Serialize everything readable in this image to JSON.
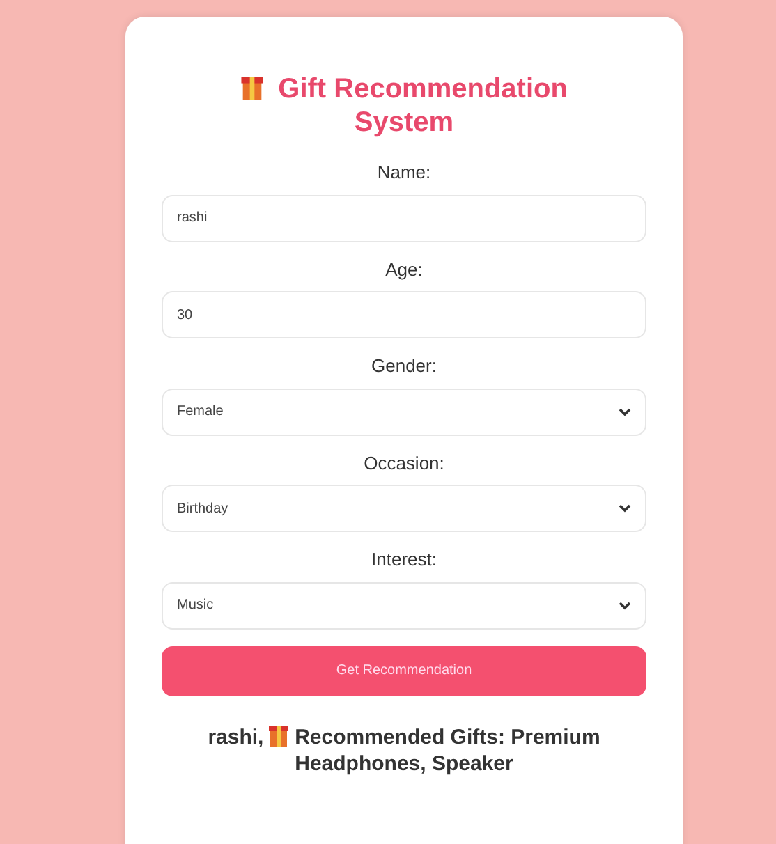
{
  "title": "Gift Recommendation System",
  "fields": [
    {
      "label": "Name:",
      "kind": "text",
      "value": "rashi"
    },
    {
      "label": "Age:",
      "kind": "text",
      "value": "30"
    },
    {
      "label": "Gender:",
      "kind": "select",
      "value": "Female"
    },
    {
      "label": "Occasion:",
      "kind": "select",
      "value": "Birthday"
    },
    {
      "label": "Interest:",
      "kind": "select",
      "value": "Music"
    }
  ],
  "submit_button": "Get Recommendation",
  "result": {
    "name": "rashi,",
    "text": "Recommended Gifts: Premium Headphones, Speaker"
  }
}
